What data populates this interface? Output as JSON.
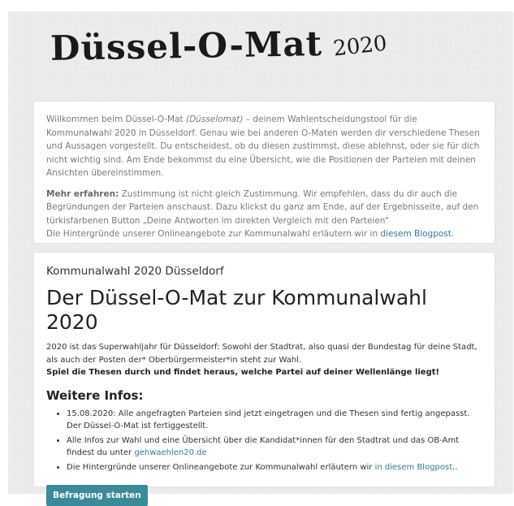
{
  "logo": {
    "title": "Düssel-O-Mat",
    "year": "2020"
  },
  "intro": {
    "p1_before": "Willkommen beim Düssel-O-Mat ",
    "p1_italic": "(Düsselomat)",
    "p1_after": " – deinem Wahlentscheidungstool für die Kommunalwahl 2020 in Düsseldorf. Genau wie bei anderen O-Maten werden dir verschiedene Thesen und Aussagen vorgestellt. Du entscheidest, ob du diesen zustimmst, diese ablehnst, oder sie für dich nicht wichtig sind. Am Ende bekommst du eine Übersicht, wie die Positionen der Parteien mit deinen Ansichten übereinstimmen.",
    "p2_bold": "Mehr erfahren:",
    "p2_text": " Zustimmung ist nicht gleich Zustimmung. Wir empfehlen, dass du dir auch die Begründungen der Parteien anschaust. Dazu klickst du ganz am Ende, auf der Ergebnisseite, auf den türkisfarbenen Button „Deine Antworten im direkten Vergleich mit den Parteien“",
    "p3_before": "Die Hintergründe unserer Onlineangebote zur Kommunalwahl erläutern wir in ",
    "p3_link": "diesem Blogpost",
    "p3_after": "."
  },
  "main": {
    "subtitle": "Kommunalwahl 2020 Düsseldorf",
    "title": "Der Düssel-O-Mat zur Kommunalwahl 2020",
    "description": "2020 ist das Superwahljahr für Düsseldorf: Sowohl der Stadtrat, also quasi der Bundestag für deine Stadt, als auch der Posten der* Oberbürgermeister*in steht zur Wahl.",
    "cta": "Spiel die Thesen durch und findet heraus, welche Partei auf deiner Wellenlänge liegt!",
    "infos_heading": "Weitere Infos:",
    "info1": "15.08.2020: Alle angefragten Parteien sind jetzt eingetragen und die Thesen sind fertig angepasst. Der Düssel-O-Mat ist fertiggestellt.",
    "info2_before": "Alle Infos zur Wahl und eine Übersicht über die Kandidat*innen für den Stadtrat und das OB-Amt findest du unter ",
    "info2_link": "gehwaehlen20.de",
    "info3_before": "Die Hintergründe unserer Onlineangebote zur Kommunalwahl erläutern wir ",
    "info3_link": "in diesem Blogpost",
    "info3_after": "..",
    "start_button": "Befragung starten"
  },
  "colors": {
    "accent": "#3b8a9a",
    "link": "#2e7d9b",
    "page_bg": "#ebebea"
  }
}
